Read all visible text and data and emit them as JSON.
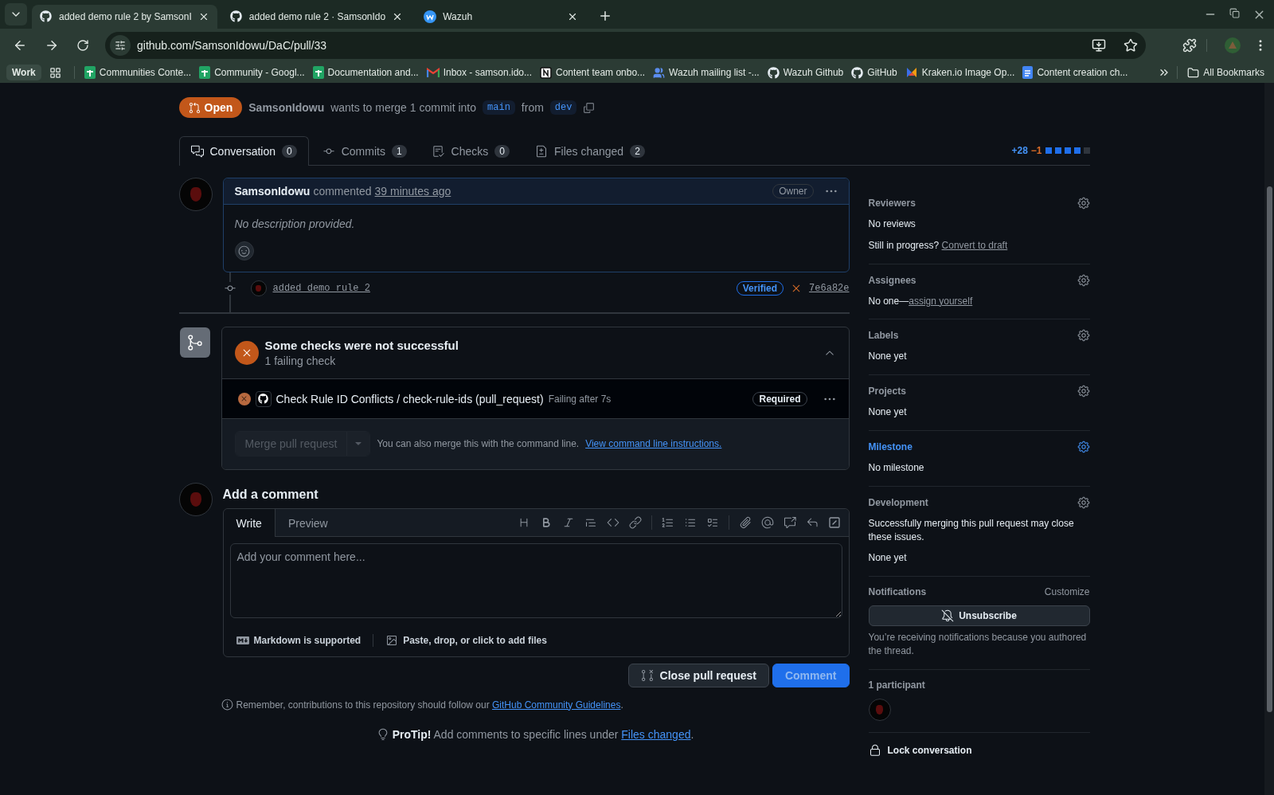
{
  "browser": {
    "tabs": [
      {
        "title": "added demo rule 2 by SamsonI",
        "kind": "github",
        "selected": true
      },
      {
        "title": "added demo rule 2 · SamsonIdo",
        "kind": "github",
        "selected": false
      },
      {
        "title": "Wazuh",
        "kind": "wazuh",
        "selected": false
      }
    ],
    "address": "github.com/SamsonIdowu/DaC/pull/33",
    "workspace": "Work",
    "bookmarks": [
      {
        "label": "Communities Conte...",
        "kind": "sheets"
      },
      {
        "label": "Community - Googl...",
        "kind": "sheets"
      },
      {
        "label": "Documentation and...",
        "kind": "sheets"
      },
      {
        "label": "Inbox - samson.ido...",
        "kind": "gmail"
      },
      {
        "label": "Content team onbo...",
        "kind": "notion"
      },
      {
        "label": "Wazuh mailing list -...",
        "kind": "group"
      },
      {
        "label": "Wazuh Github",
        "kind": "github"
      },
      {
        "label": "GitHub",
        "kind": "github"
      },
      {
        "label": "Kraken.io Image Op...",
        "kind": "kraken"
      },
      {
        "label": "Content creation ch...",
        "kind": "docs"
      }
    ],
    "all_bookmarks": "All Bookmarks"
  },
  "pr": {
    "state": "Open",
    "author": "SamsonIdowu",
    "text_1": "wants to merge 1 commit into",
    "base": "main",
    "text_2": "from",
    "head": "dev"
  },
  "tabs": [
    {
      "label": "Conversation",
      "count": "0",
      "kind": "conversation",
      "selected": true
    },
    {
      "label": "Commits",
      "count": "1",
      "kind": "commit",
      "selected": false
    },
    {
      "label": "Checks",
      "count": "0",
      "kind": "checks",
      "selected": false
    },
    {
      "label": "Files changed",
      "count": "2",
      "kind": "files",
      "selected": false
    }
  ],
  "diffstat": {
    "additions": "+28",
    "deletions": "−1",
    "blocks": [
      {
        "kind": "added"
      },
      {
        "kind": "added"
      },
      {
        "kind": "added"
      },
      {
        "kind": "added"
      },
      {
        "kind": "neutral"
      }
    ]
  },
  "comment": {
    "author": "SamsonIdowu",
    "action": "commented",
    "time": "39 minutes ago",
    "badge": "Owner",
    "body": "No description provided."
  },
  "commit": {
    "message": "added demo rule 2",
    "verified": "Verified",
    "sha": "7e6a82e"
  },
  "checks": {
    "title": "Some checks were not successful",
    "subtitle": "1 failing check",
    "expanded": true,
    "items": [
      {
        "name": "Check Rule ID Conflicts / check-rule-ids (pull_request)",
        "status": "Failing after 7s",
        "badge": "Required"
      }
    ],
    "merge_button": {
      "label": "Merge pull request",
      "disabled": true
    },
    "note": "You can also merge this with the command line.",
    "link": "View command line instructions."
  },
  "add_comment": {
    "heading": "Add a comment",
    "tabs": [
      {
        "label": "Write",
        "selected": true
      },
      {
        "label": "Preview",
        "selected": false
      }
    ],
    "placeholder": "Add your comment here...",
    "markdown": "Markdown is supported",
    "attach": "Paste, drop, or click to add files",
    "close_button": "Close pull request",
    "comment_button": {
      "label": "Comment",
      "disabled": true
    }
  },
  "reminder": {
    "text": "Remember, contributions to this repository should follow our",
    "link": "GitHub Community Guidelines",
    "end": "."
  },
  "protip": {
    "label": "ProTip!",
    "text": "Add comments to specific lines under",
    "link": "Files changed",
    "end": "."
  },
  "sidebar": {
    "sections": [
      {
        "title": "Reviewers",
        "active": false,
        "lines": [
          {
            "text": "No reviews"
          },
          {
            "text": "Still in progress?",
            "link": "Convert to draft"
          }
        ]
      },
      {
        "title": "Assignees",
        "active": false,
        "lines": [
          {
            "text": "No one—",
            "link": "assign yourself"
          }
        ]
      },
      {
        "title": "Labels",
        "active": false,
        "lines": [
          {
            "text": "None yet"
          }
        ]
      },
      {
        "title": "Projects",
        "active": false,
        "lines": [
          {
            "text": "None yet"
          }
        ]
      },
      {
        "title": "Milestone",
        "active": true,
        "lines": [
          {
            "text": "No milestone"
          }
        ]
      },
      {
        "title": "Development",
        "active": false,
        "lines": [
          {
            "text": "Successfully merging this pull request may close these issues."
          },
          {
            "text": "None yet"
          }
        ]
      }
    ],
    "notifications": {
      "title": "Notifications",
      "customize": "Customize",
      "button": "Unsubscribe",
      "note": "You’re receiving notifications because you authored the thread."
    },
    "participants": "1 participant",
    "lock": "Lock conversation"
  }
}
